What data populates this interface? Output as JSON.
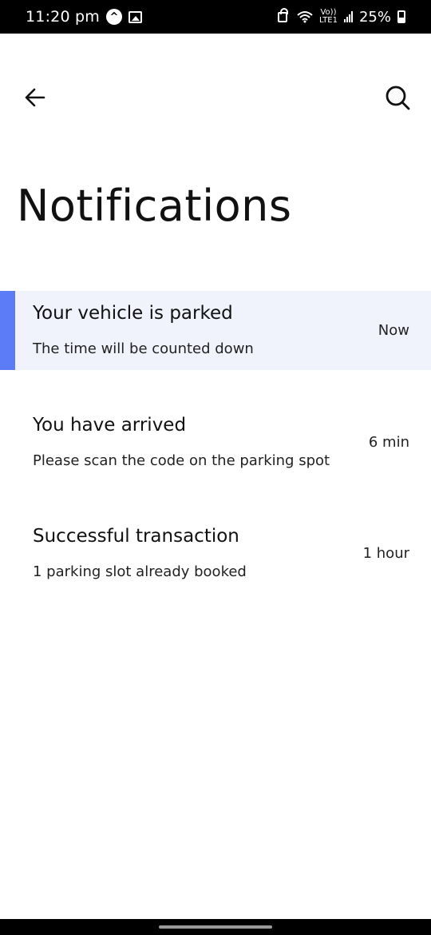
{
  "status_bar": {
    "time": "11:20 pm",
    "volte": "Vo))",
    "lte": "LTE1",
    "battery": "25%"
  },
  "app_bar": {
    "back_icon": "arrow-left-icon",
    "search_icon": "search-icon"
  },
  "page": {
    "title": "Notifications"
  },
  "notifications": [
    {
      "title": "Your vehicle is parked",
      "body": "The time will be counted down",
      "time": "Now",
      "highlighted": true
    },
    {
      "title": "You have arrived",
      "body": "Please scan the code on the parking spot",
      "time": "6 min",
      "highlighted": false
    },
    {
      "title": "Successful transaction",
      "body": "1 parking slot already booked",
      "time": "1 hour",
      "highlighted": false
    }
  ],
  "colors": {
    "accent": "#5b7cf5",
    "highlight_bg": "#f1f3fc"
  }
}
